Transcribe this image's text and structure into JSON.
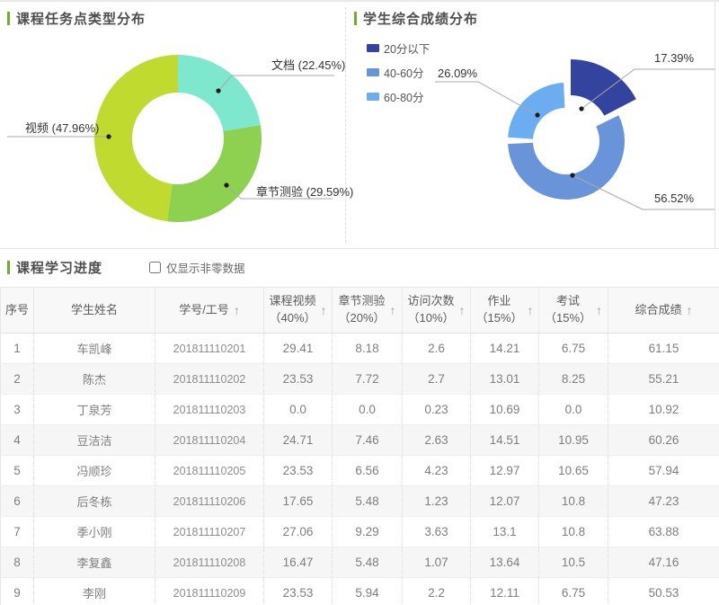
{
  "chart_data": [
    {
      "type": "pie",
      "variant": "donut",
      "title": "课程任务点类型分布",
      "legend_position": "none",
      "series": [
        {
          "name": "文档",
          "value": 22.45,
          "label": "文档 (22.45%)",
          "color": "#7de8cd"
        },
        {
          "name": "章节测验",
          "value": 29.59,
          "label": "章节测验 (29.59%)",
          "color": "#8ed04f"
        },
        {
          "name": "视频",
          "value": 47.96,
          "label": "视频 (47.96%)",
          "color": "#c0da2f"
        }
      ]
    },
    {
      "type": "pie",
      "variant": "donut",
      "title": "学生综合成绩分布",
      "legend_position": "top-left",
      "series": [
        {
          "name": "20分以下",
          "value": 17.39,
          "label": "17.39%",
          "color": "#34439d",
          "selected": true
        },
        {
          "name": "40-60分",
          "value": 56.52,
          "label": "56.52%",
          "color": "#6a94da",
          "selected": false
        },
        {
          "name": "60-80分",
          "value": 26.09,
          "label": "26.09%",
          "color": "#6cadf2",
          "selected": false
        }
      ]
    }
  ],
  "progress_section": {
    "title": "课程学习进度",
    "filter_checkbox": {
      "label": "仅显示非零数据",
      "checked": false
    }
  },
  "icons": {
    "sort_asc": "↑"
  },
  "table": {
    "columns": [
      {
        "label": "序号",
        "sublabel": "",
        "sortable": false
      },
      {
        "label": "学生姓名",
        "sublabel": "",
        "sortable": false
      },
      {
        "label": "学号/工号",
        "sublabel": "",
        "sortable": true
      },
      {
        "label": "课程视频",
        "sublabel": "（40%）",
        "sortable": true
      },
      {
        "label": "章节测验",
        "sublabel": "（20%）",
        "sortable": true
      },
      {
        "label": "访问次数",
        "sublabel": "（10%）",
        "sortable": true
      },
      {
        "label": "作业",
        "sublabel": "（15%）",
        "sortable": true
      },
      {
        "label": "考试",
        "sublabel": "（15%）",
        "sortable": true
      },
      {
        "label": "综合成绩",
        "sublabel": "",
        "sortable": true
      }
    ],
    "rows": [
      [
        "1",
        "车凯峰",
        "201811110201",
        "29.41",
        "8.18",
        "2.6",
        "14.21",
        "6.75",
        "61.15"
      ],
      [
        "2",
        "陈杰",
        "201811110202",
        "23.53",
        "7.72",
        "2.7",
        "13.01",
        "8.25",
        "55.21"
      ],
      [
        "3",
        "丁泉芳",
        "201811110203",
        "0.0",
        "0.0",
        "0.23",
        "10.69",
        "0.0",
        "10.92"
      ],
      [
        "4",
        "豆洁洁",
        "201811110204",
        "24.71",
        "7.46",
        "2.63",
        "14.51",
        "10.95",
        "60.26"
      ],
      [
        "5",
        "冯顺珍",
        "201811110205",
        "23.53",
        "6.56",
        "4.23",
        "12.97",
        "10.65",
        "57.94"
      ],
      [
        "6",
        "后冬栋",
        "201811110206",
        "17.65",
        "5.48",
        "1.23",
        "12.07",
        "10.8",
        "47.23"
      ],
      [
        "7",
        "季小刚",
        "201811110207",
        "27.06",
        "9.29",
        "3.63",
        "13.1",
        "10.8",
        "63.88"
      ],
      [
        "8",
        "李复鑫",
        "201811110208",
        "16.47",
        "5.48",
        "1.07",
        "13.64",
        "10.5",
        "47.16"
      ],
      [
        "9",
        "李刚",
        "201811110209",
        "23.53",
        "5.94",
        "2.2",
        "12.11",
        "6.75",
        "50.53"
      ]
    ]
  }
}
